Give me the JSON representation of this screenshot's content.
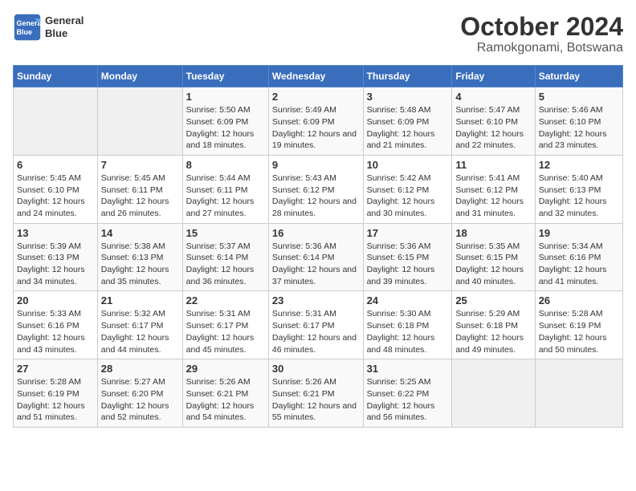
{
  "header": {
    "logo_line1": "General",
    "logo_line2": "Blue",
    "title": "October 2024",
    "subtitle": "Ramokgonami, Botswana"
  },
  "columns": [
    "Sunday",
    "Monday",
    "Tuesday",
    "Wednesday",
    "Thursday",
    "Friday",
    "Saturday"
  ],
  "weeks": [
    [
      {
        "date": "",
        "sunrise": "",
        "sunset": "",
        "daylight": ""
      },
      {
        "date": "",
        "sunrise": "",
        "sunset": "",
        "daylight": ""
      },
      {
        "date": "1",
        "sunrise": "Sunrise: 5:50 AM",
        "sunset": "Sunset: 6:09 PM",
        "daylight": "Daylight: 12 hours and 18 minutes."
      },
      {
        "date": "2",
        "sunrise": "Sunrise: 5:49 AM",
        "sunset": "Sunset: 6:09 PM",
        "daylight": "Daylight: 12 hours and 19 minutes."
      },
      {
        "date": "3",
        "sunrise": "Sunrise: 5:48 AM",
        "sunset": "Sunset: 6:09 PM",
        "daylight": "Daylight: 12 hours and 21 minutes."
      },
      {
        "date": "4",
        "sunrise": "Sunrise: 5:47 AM",
        "sunset": "Sunset: 6:10 PM",
        "daylight": "Daylight: 12 hours and 22 minutes."
      },
      {
        "date": "5",
        "sunrise": "Sunrise: 5:46 AM",
        "sunset": "Sunset: 6:10 PM",
        "daylight": "Daylight: 12 hours and 23 minutes."
      }
    ],
    [
      {
        "date": "6",
        "sunrise": "Sunrise: 5:45 AM",
        "sunset": "Sunset: 6:10 PM",
        "daylight": "Daylight: 12 hours and 24 minutes."
      },
      {
        "date": "7",
        "sunrise": "Sunrise: 5:45 AM",
        "sunset": "Sunset: 6:11 PM",
        "daylight": "Daylight: 12 hours and 26 minutes."
      },
      {
        "date": "8",
        "sunrise": "Sunrise: 5:44 AM",
        "sunset": "Sunset: 6:11 PM",
        "daylight": "Daylight: 12 hours and 27 minutes."
      },
      {
        "date": "9",
        "sunrise": "Sunrise: 5:43 AM",
        "sunset": "Sunset: 6:12 PM",
        "daylight": "Daylight: 12 hours and 28 minutes."
      },
      {
        "date": "10",
        "sunrise": "Sunrise: 5:42 AM",
        "sunset": "Sunset: 6:12 PM",
        "daylight": "Daylight: 12 hours and 30 minutes."
      },
      {
        "date": "11",
        "sunrise": "Sunrise: 5:41 AM",
        "sunset": "Sunset: 6:12 PM",
        "daylight": "Daylight: 12 hours and 31 minutes."
      },
      {
        "date": "12",
        "sunrise": "Sunrise: 5:40 AM",
        "sunset": "Sunset: 6:13 PM",
        "daylight": "Daylight: 12 hours and 32 minutes."
      }
    ],
    [
      {
        "date": "13",
        "sunrise": "Sunrise: 5:39 AM",
        "sunset": "Sunset: 6:13 PM",
        "daylight": "Daylight: 12 hours and 34 minutes."
      },
      {
        "date": "14",
        "sunrise": "Sunrise: 5:38 AM",
        "sunset": "Sunset: 6:13 PM",
        "daylight": "Daylight: 12 hours and 35 minutes."
      },
      {
        "date": "15",
        "sunrise": "Sunrise: 5:37 AM",
        "sunset": "Sunset: 6:14 PM",
        "daylight": "Daylight: 12 hours and 36 minutes."
      },
      {
        "date": "16",
        "sunrise": "Sunrise: 5:36 AM",
        "sunset": "Sunset: 6:14 PM",
        "daylight": "Daylight: 12 hours and 37 minutes."
      },
      {
        "date": "17",
        "sunrise": "Sunrise: 5:36 AM",
        "sunset": "Sunset: 6:15 PM",
        "daylight": "Daylight: 12 hours and 39 minutes."
      },
      {
        "date": "18",
        "sunrise": "Sunrise: 5:35 AM",
        "sunset": "Sunset: 6:15 PM",
        "daylight": "Daylight: 12 hours and 40 minutes."
      },
      {
        "date": "19",
        "sunrise": "Sunrise: 5:34 AM",
        "sunset": "Sunset: 6:16 PM",
        "daylight": "Daylight: 12 hours and 41 minutes."
      }
    ],
    [
      {
        "date": "20",
        "sunrise": "Sunrise: 5:33 AM",
        "sunset": "Sunset: 6:16 PM",
        "daylight": "Daylight: 12 hours and 43 minutes."
      },
      {
        "date": "21",
        "sunrise": "Sunrise: 5:32 AM",
        "sunset": "Sunset: 6:17 PM",
        "daylight": "Daylight: 12 hours and 44 minutes."
      },
      {
        "date": "22",
        "sunrise": "Sunrise: 5:31 AM",
        "sunset": "Sunset: 6:17 PM",
        "daylight": "Daylight: 12 hours and 45 minutes."
      },
      {
        "date": "23",
        "sunrise": "Sunrise: 5:31 AM",
        "sunset": "Sunset: 6:17 PM",
        "daylight": "Daylight: 12 hours and 46 minutes."
      },
      {
        "date": "24",
        "sunrise": "Sunrise: 5:30 AM",
        "sunset": "Sunset: 6:18 PM",
        "daylight": "Daylight: 12 hours and 48 minutes."
      },
      {
        "date": "25",
        "sunrise": "Sunrise: 5:29 AM",
        "sunset": "Sunset: 6:18 PM",
        "daylight": "Daylight: 12 hours and 49 minutes."
      },
      {
        "date": "26",
        "sunrise": "Sunrise: 5:28 AM",
        "sunset": "Sunset: 6:19 PM",
        "daylight": "Daylight: 12 hours and 50 minutes."
      }
    ],
    [
      {
        "date": "27",
        "sunrise": "Sunrise: 5:28 AM",
        "sunset": "Sunset: 6:19 PM",
        "daylight": "Daylight: 12 hours and 51 minutes."
      },
      {
        "date": "28",
        "sunrise": "Sunrise: 5:27 AM",
        "sunset": "Sunset: 6:20 PM",
        "daylight": "Daylight: 12 hours and 52 minutes."
      },
      {
        "date": "29",
        "sunrise": "Sunrise: 5:26 AM",
        "sunset": "Sunset: 6:21 PM",
        "daylight": "Daylight: 12 hours and 54 minutes."
      },
      {
        "date": "30",
        "sunrise": "Sunrise: 5:26 AM",
        "sunset": "Sunset: 6:21 PM",
        "daylight": "Daylight: 12 hours and 55 minutes."
      },
      {
        "date": "31",
        "sunrise": "Sunrise: 5:25 AM",
        "sunset": "Sunset: 6:22 PM",
        "daylight": "Daylight: 12 hours and 56 minutes."
      },
      {
        "date": "",
        "sunrise": "",
        "sunset": "",
        "daylight": ""
      },
      {
        "date": "",
        "sunrise": "",
        "sunset": "",
        "daylight": ""
      }
    ]
  ]
}
